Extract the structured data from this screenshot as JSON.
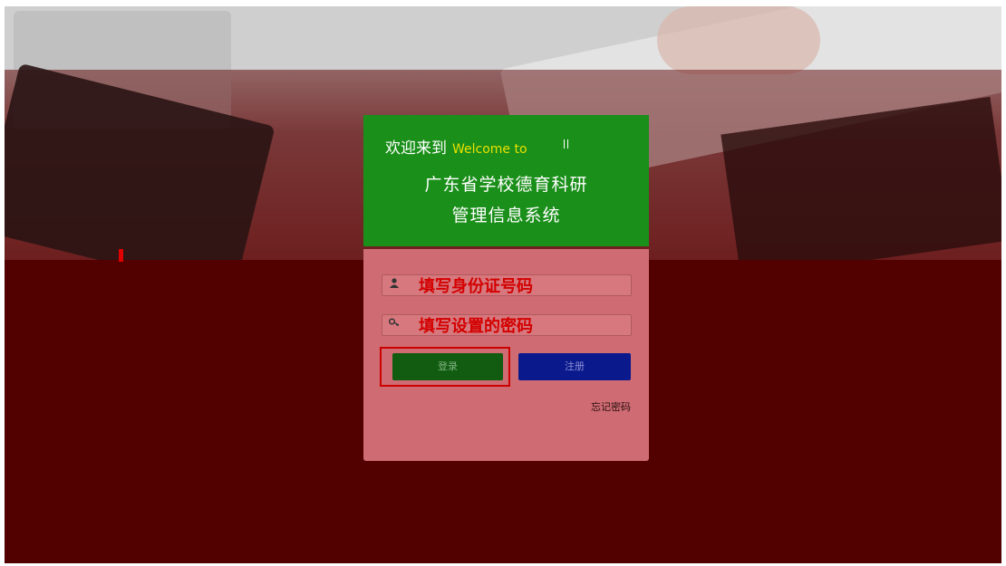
{
  "login": {
    "welcome_cn": "欢迎来到",
    "welcome_en": "Welcome to",
    "system_line1": "广东省学校德育科研",
    "system_line2": "管理信息系统",
    "id_annotation": "填写身份证号码",
    "password_annotation": "填写设置的密码",
    "login_button": "登录",
    "register_button": "注册",
    "forgot_password": "忘记密码"
  },
  "icons": {
    "user_field": "user-icon",
    "password_field": "key-icon"
  },
  "colors": {
    "header_green": "#1a8f1a",
    "panel_pink": "#cf6b72",
    "login_green": "#125c12",
    "register_blue": "#0a1a8c",
    "annotation_red": "#d40000"
  }
}
